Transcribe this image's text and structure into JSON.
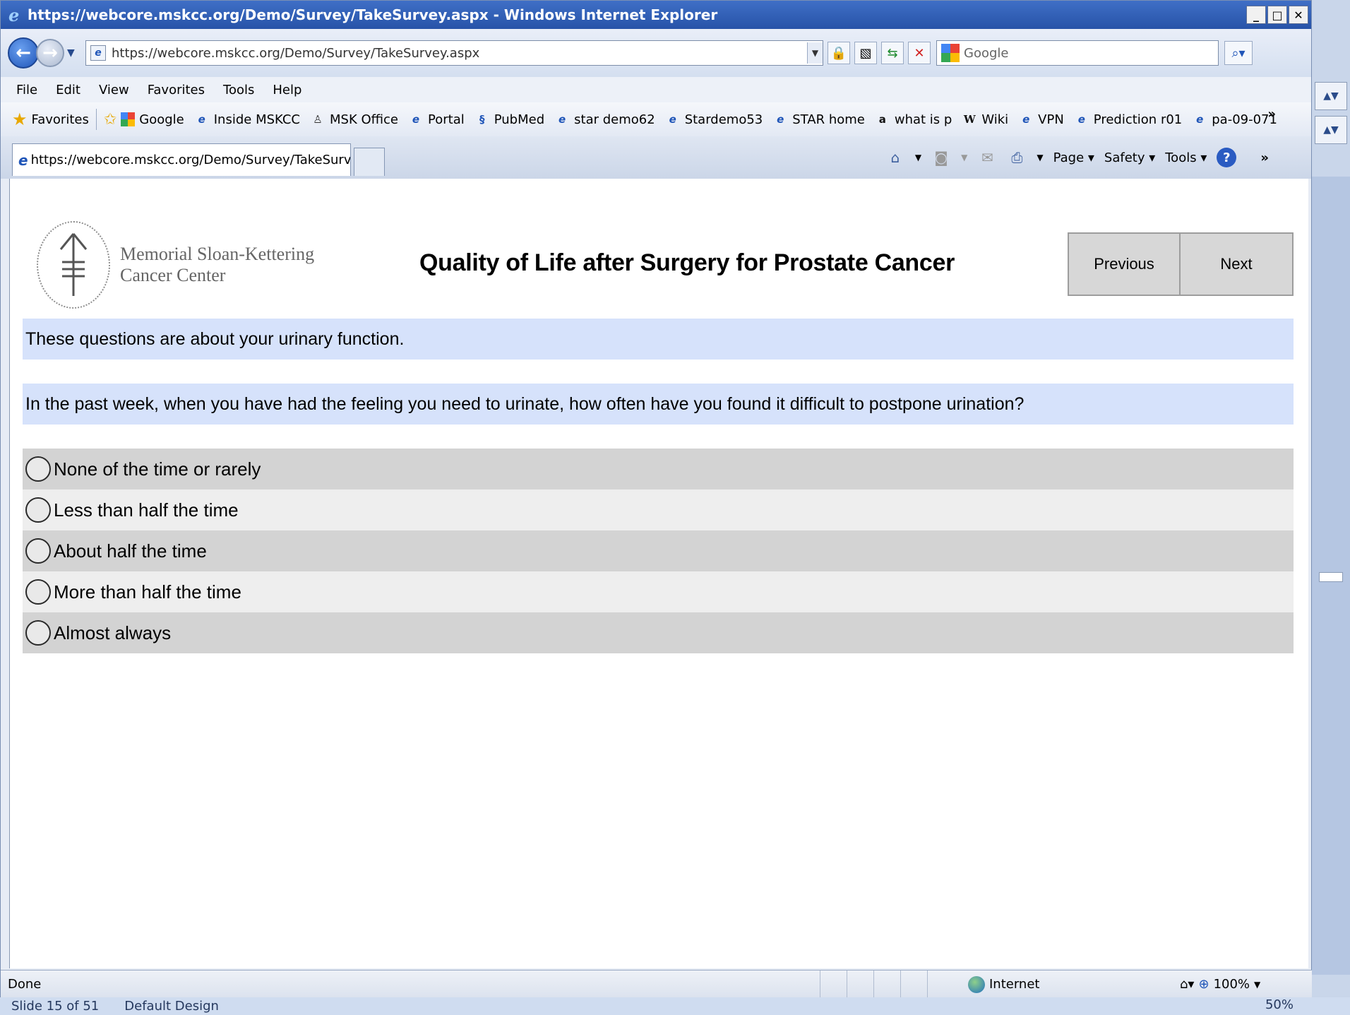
{
  "window": {
    "title": "https://webcore.mskcc.org/Demo/Survey/TakeSurvey.aspx - Windows Internet Explorer",
    "min": "_",
    "max": "□",
    "close": "✕"
  },
  "nav": {
    "address_url": "https://webcore.mskcc.org/Demo/Survey/TakeSurvey.aspx",
    "search_placeholder": "Google"
  },
  "menu": [
    "File",
    "Edit",
    "View",
    "Favorites",
    "Tools",
    "Help"
  ],
  "favorites": {
    "label": "Favorites",
    "items": [
      {
        "label": "Google",
        "icon": "google-icon"
      },
      {
        "label": "Inside MSKCC",
        "icon": "ie-page-icon"
      },
      {
        "label": "MSK Office",
        "icon": "linux-icon"
      },
      {
        "label": "Portal",
        "icon": "ie-page-icon"
      },
      {
        "label": "PubMed",
        "icon": "pubmed-icon"
      },
      {
        "label": "star demo62",
        "icon": "ie-page-icon"
      },
      {
        "label": "Stardemo53",
        "icon": "ie-page-icon"
      },
      {
        "label": "STAR home",
        "icon": "ie-page-icon"
      },
      {
        "label": "what is p",
        "icon": "amazon-icon"
      },
      {
        "label": "Wiki",
        "icon": "wikipedia-icon"
      },
      {
        "label": "VPN",
        "icon": "ie-page-icon"
      },
      {
        "label": "Prediction r01",
        "icon": "ie-page-icon"
      },
      {
        "label": "pa-09-071",
        "icon": "ie-page-icon"
      }
    ]
  },
  "tab": {
    "label": "https://webcore.mskcc.org/Demo/Survey/TakeSurve..."
  },
  "command_bar": {
    "page": "Page",
    "safety": "Safety",
    "tools": "Tools"
  },
  "page": {
    "logo_line1": "Memorial Sloan-Kettering",
    "logo_line2": "Cancer Center",
    "title": "Quality of Life after Surgery for Prostate Cancer",
    "previous": "Previous",
    "next": "Next",
    "intro": "These questions are about your urinary function.",
    "question": "In the past week, when you have had the feeling you need to urinate, how often have you found it difficult to postpone urination?",
    "options": [
      "None of the time or rarely",
      "Less than half the time",
      "About half the time",
      "More than half the time",
      "Almost always"
    ]
  },
  "status": {
    "text": "Done",
    "zone": "Internet",
    "zoom": "100%"
  },
  "background_app": {
    "slide": "Slide 15 of 51",
    "design": "Default Design",
    "zoom": "50%"
  },
  "colors": {
    "band_blue": "#d6e2fb",
    "option_dark": "#d3d3d3",
    "option_light": "#eeeeee",
    "title_bar": "#2753a8"
  }
}
